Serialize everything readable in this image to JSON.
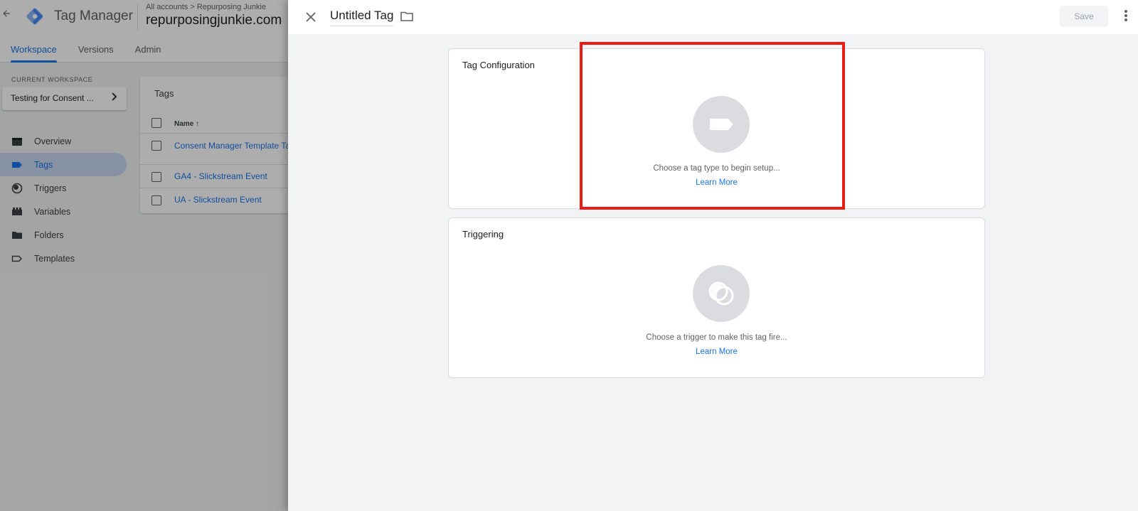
{
  "app": {
    "name": "Tag Manager",
    "breadcrumb": "All accounts > Repurposing Junkie",
    "account": "repurposingjunkie.com",
    "nav_tabs": [
      "Workspace",
      "Versions",
      "Admin"
    ]
  },
  "workspace": {
    "label": "CURRENT WORKSPACE",
    "name": "Testing for Consent ..."
  },
  "sidebar": {
    "items": [
      {
        "label": "Overview",
        "icon": "overview-icon"
      },
      {
        "label": "Tags",
        "icon": "tag-icon"
      },
      {
        "label": "Triggers",
        "icon": "trigger-icon"
      },
      {
        "label": "Variables",
        "icon": "variables-icon"
      },
      {
        "label": "Folders",
        "icon": "folder-icon"
      },
      {
        "label": "Templates",
        "icon": "template-icon"
      }
    ]
  },
  "tags_list": {
    "title": "Tags",
    "column_name": "Name ↑",
    "rows": [
      "Consent Manager Template Ta",
      "GA4 - Slickstream Event",
      "UA - Slickstream Event"
    ]
  },
  "panel": {
    "title": "Untitled Tag",
    "save_label": "Save",
    "tag_config": {
      "title": "Tag Configuration",
      "hint": "Choose a tag type to begin setup...",
      "learn_more": "Learn More"
    },
    "triggering": {
      "title": "Triggering",
      "hint": "Choose a trigger to make this tag fire...",
      "learn_more": "Learn More"
    }
  },
  "colors": {
    "accent": "#1a73e8",
    "highlight": "#ea1b14"
  }
}
